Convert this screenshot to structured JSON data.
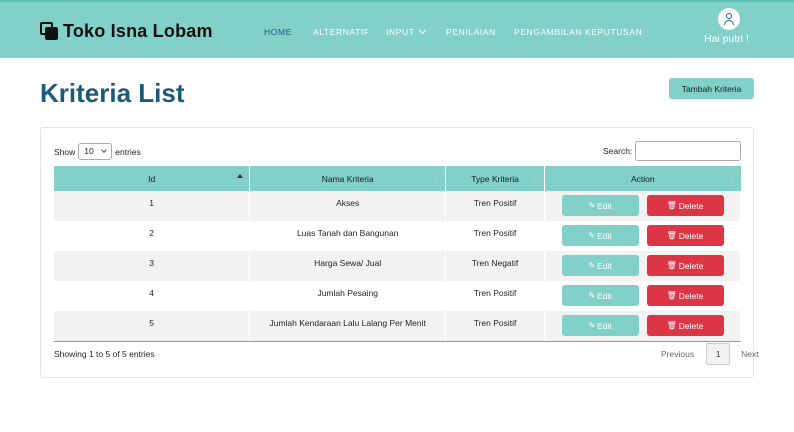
{
  "brand": {
    "name": "Toko Isna Lobam",
    "icon": "stacked-squares-icon"
  },
  "nav": {
    "items": [
      {
        "label": "HOME",
        "active": true
      },
      {
        "label": "ALTERNATIF",
        "active": false
      },
      {
        "label": "INPUT",
        "active": false,
        "dropdown": true
      },
      {
        "label": "PENILAIAN",
        "active": false
      },
      {
        "label": "PENGAMBILAN KEPUTUSAN",
        "active": false
      }
    ],
    "user_greeting": "Hai putri !",
    "user_icon": "user-icon"
  },
  "page": {
    "title": "Kriteria List",
    "add_button": "Tambah Kriteria"
  },
  "table_controls": {
    "show_label": "Show",
    "entries_value": "10",
    "entries_label": "entries",
    "search_label": "Search:",
    "search_value": ""
  },
  "table": {
    "columns": [
      "Id",
      "Nama Kriteria",
      "Type Kriteria",
      "Action"
    ],
    "rows": [
      {
        "id": "1",
        "nama": "Akses",
        "type": "Tren Positif"
      },
      {
        "id": "2",
        "nama": "Luas Tanah dan Bangunan",
        "type": "Tren Positif"
      },
      {
        "id": "3",
        "nama": "Harga Sewa/ Jual",
        "type": "Tren Negatif"
      },
      {
        "id": "4",
        "nama": "Jumlah Pesaing",
        "type": "Tren Positif"
      },
      {
        "id": "5",
        "nama": "Jumlah Kendaraan Lalu Lalang Per Menit",
        "type": "Tren Positif"
      }
    ],
    "edit_label": "Edit",
    "delete_label": "Delete"
  },
  "footer": {
    "info": "Showing 1 to 5 of 5 entries",
    "previous": "Previous",
    "page": "1",
    "next": "Next"
  },
  "colors": {
    "accent": "#81d1c9",
    "title": "#1d5a78",
    "danger": "#dc3545"
  }
}
